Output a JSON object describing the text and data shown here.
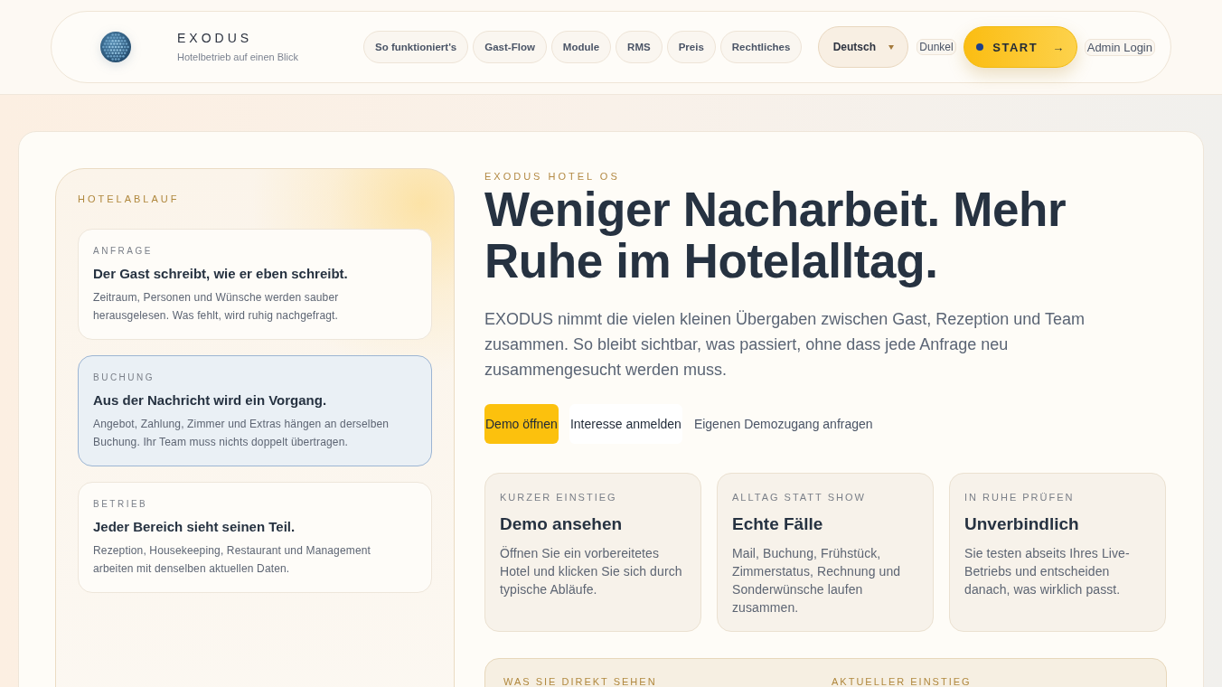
{
  "header": {
    "brand": {
      "name": "EXODUS",
      "tagline": "Hotelbetrieb auf einen Blick"
    },
    "nav": [
      "So funktioniert's",
      "Gast-Flow",
      "Module",
      "RMS",
      "Preis",
      "Rechtliches"
    ],
    "language_select": {
      "value": "Deutsch"
    },
    "theme_toggle": "Dunkel",
    "start_button": {
      "label": "START",
      "arrow": "→"
    },
    "admin_login": "Admin Login"
  },
  "flow_panel": {
    "heading": "HOTELABLAUF",
    "steps": [
      {
        "label": "ANFRAGE",
        "title": "Der Gast schreibt, wie er eben schreibt.",
        "text": "Zeitraum, Personen und Wünsche werden sauber herausgelesen. Was fehlt, wird ruhig nachgefragt.",
        "selected": false
      },
      {
        "label": "BUCHUNG",
        "title": "Aus der Nachricht wird ein Vorgang.",
        "text": "Angebot, Zahlung, Zimmer und Extras hängen an derselben Buchung. Ihr Team muss nichts doppelt übertragen.",
        "selected": true
      },
      {
        "label": "BETRIEB",
        "title": "Jeder Bereich sieht seinen Teil.",
        "text": "Rezeption, Housekeeping, Restaurant und Management arbeiten mit denselben aktuellen Daten.",
        "selected": false
      }
    ]
  },
  "hero": {
    "eyebrow": "EXODUS HOTEL OS",
    "title": "Weniger Nacharbeit. Mehr Ruhe im Hotelalltag.",
    "intro": "EXODUS nimmt die vielen kleinen Übergaben zwischen Gast, Rezeption und Team zusammen. So bleibt sichtbar, was passiert, ohne dass jede Anfrage neu zusammengesucht werden muss.",
    "actions": [
      {
        "label": "Demo öffnen",
        "kind": "primary"
      },
      {
        "label": "Interesse anmelden",
        "kind": "secondary"
      },
      {
        "label": "Eigenen Demozugang anfragen",
        "kind": "link"
      }
    ]
  },
  "features": [
    {
      "label": "KURZER EINSTIEG",
      "title": "Demo ansehen",
      "text": "Öffnen Sie ein vorbereitetes Hotel und klicken Sie sich durch typische Abläufe."
    },
    {
      "label": "ALLTAG STATT SHOW",
      "title": "Echte Fälle",
      "text": "Mail, Buchung, Frühstück, Zimmerstatus, Rechnung und Sonderwünsche laufen zusammen."
    },
    {
      "label": "IN RUHE PRÜFEN",
      "title": "Unverbindlich",
      "text": "Sie testen abseits Ihres Live-Betriebs und entscheiden danach, was wirklich passt."
    }
  ],
  "summary_panel": {
    "columns": [
      "WAS SIE DIREKT SEHEN",
      "AKTUELLER EINSTIEG"
    ]
  }
}
